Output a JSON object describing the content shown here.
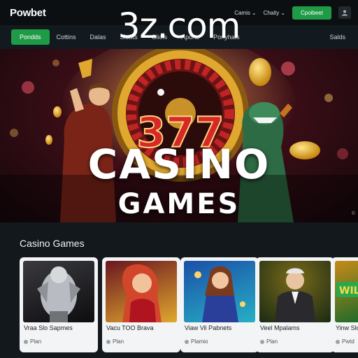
{
  "watermark": "3z.com",
  "header": {
    "logo_main": "Powbet",
    "links": [
      {
        "label": "Camis",
        "icon": "chevron-down-icon"
      },
      {
        "label": "Chaity",
        "icon": "chevron-down-icon"
      }
    ],
    "cta_label": "Cpoibeet",
    "user_icon": "user-icon"
  },
  "nav": {
    "items": [
      "Pondds",
      "Cottins",
      "Dalas",
      "Slobts",
      "Gliols",
      "Aports",
      "Ponyhats"
    ],
    "active_index": 0,
    "right_item": "Salds"
  },
  "hero": {
    "badge": "377",
    "title": "CASINO",
    "subtitle": "GAMES",
    "copyright": "©"
  },
  "section": {
    "title": "Casino Games",
    "cards": [
      {
        "title": "Vraa Slo Sapmes",
        "meta": "Plan",
        "art": "silver-warrior"
      },
      {
        "title": "Vacu TOO Brava",
        "meta": "Plan",
        "art": "red-hair-heroine"
      },
      {
        "title": "Viaw Vil Pabnets",
        "meta": "Plamio",
        "art": "blue-fantasy-heroine"
      },
      {
        "title": "Veel Mpalams",
        "meta": "Plan",
        "art": "gentleman-dealer"
      },
      {
        "title": "Yinw Slo",
        "meta": "Pwtd",
        "art": "wild-slot"
      }
    ]
  },
  "colors": {
    "accent_green": "#1f9b47",
    "hero_red": "#6b1822",
    "gold": "#e0a82e",
    "page_bg": "#12181c"
  }
}
